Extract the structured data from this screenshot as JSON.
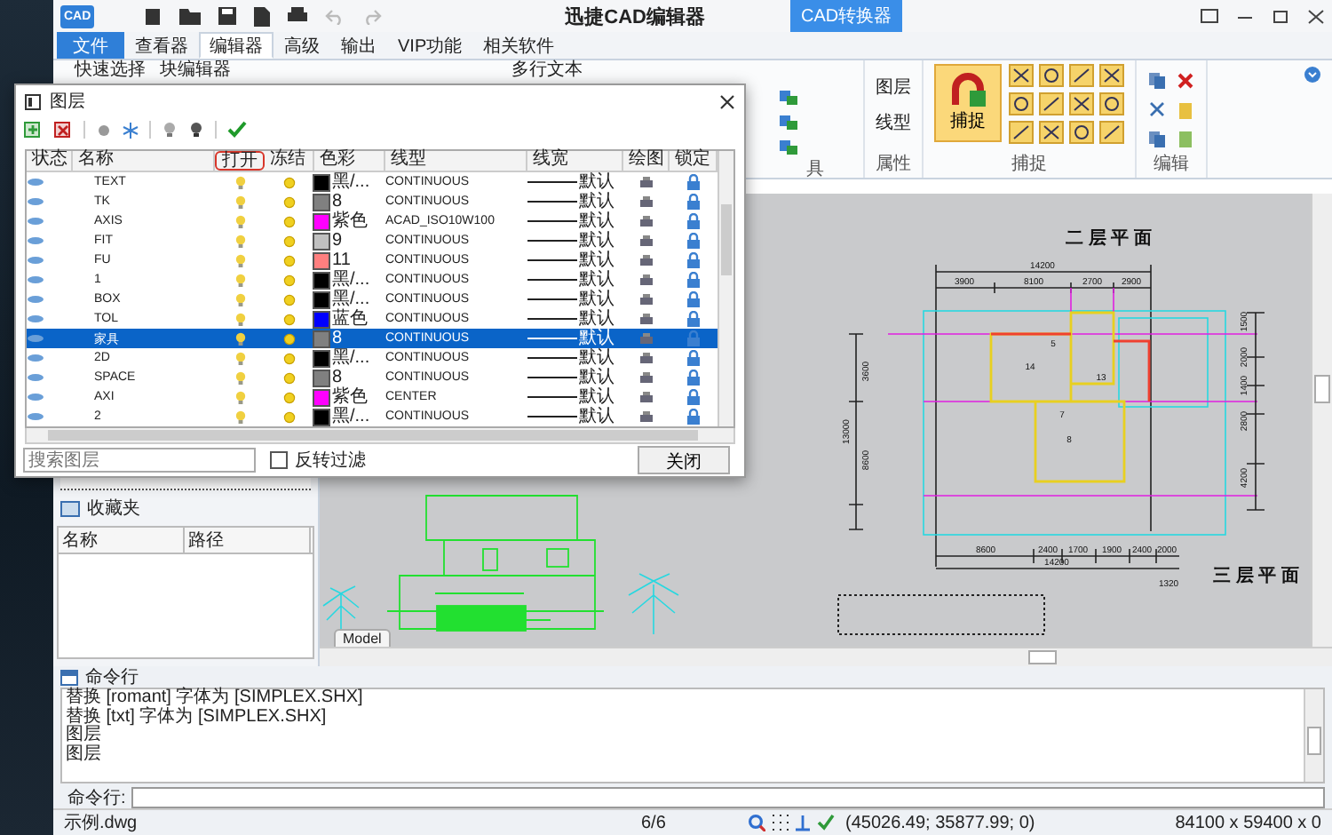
{
  "app": {
    "logo": "CAD",
    "title": "迅捷CAD编辑器",
    "converter_button": "CAD转换器"
  },
  "menu_tabs": [
    {
      "label": "文件",
      "kind": "file",
      "selected": false
    },
    {
      "label": "查看器",
      "kind": "tab",
      "selected": false
    },
    {
      "label": "编辑器",
      "kind": "tab",
      "selected": true
    },
    {
      "label": "高级",
      "kind": "tab",
      "selected": false
    },
    {
      "label": "输出",
      "kind": "tab",
      "selected": false
    },
    {
      "label": "VIP功能",
      "kind": "tab",
      "selected": false
    },
    {
      "label": "相关软件",
      "kind": "tab",
      "selected": false
    }
  ],
  "ribbon": {
    "left_buttons": [
      "快速选择",
      "块编辑器"
    ],
    "text_button": "多行文本",
    "tools_label": "具",
    "properties": {
      "label": "属性",
      "buttons": [
        "图层",
        "线型"
      ]
    },
    "snap": {
      "label": "捕捉",
      "button": "捕捉"
    },
    "edit": {
      "label": "编辑"
    }
  },
  "layer_dialog": {
    "title": "图层",
    "columns": [
      {
        "label": "状态",
        "highlighted": false
      },
      {
        "label": "名称",
        "highlighted": false
      },
      {
        "label": "打开",
        "highlighted": true
      },
      {
        "label": "冻结",
        "highlighted": false
      },
      {
        "label": "色彩",
        "highlighted": false
      },
      {
        "label": "线型",
        "highlighted": false
      },
      {
        "label": "线宽",
        "highlighted": false
      },
      {
        "label": "绘图",
        "highlighted": false
      },
      {
        "label": "锁定",
        "highlighted": false
      }
    ],
    "rows": [
      {
        "name": "TEXT",
        "color": "#000000",
        "color_label": "黑/...",
        "linetype": "CONTINUOUS",
        "lineweight": "默认",
        "selected": false
      },
      {
        "name": "TK",
        "color": "#808080",
        "color_label": "8",
        "linetype": "CONTINUOUS",
        "lineweight": "默认",
        "selected": false
      },
      {
        "name": "AXIS",
        "color": "#ff00ff",
        "color_label": "紫色",
        "linetype": "ACAD_ISO10W100",
        "lineweight": "默认",
        "selected": false
      },
      {
        "name": "FIT",
        "color": "#c0c0c0",
        "color_label": "9",
        "linetype": "CONTINUOUS",
        "lineweight": "默认",
        "selected": false
      },
      {
        "name": "FU",
        "color": "#ff7f7f",
        "color_label": "11",
        "linetype": "CONTINUOUS",
        "lineweight": "默认",
        "selected": false
      },
      {
        "name": "1",
        "color": "#000000",
        "color_label": "黑/...",
        "linetype": "CONTINUOUS",
        "lineweight": "默认",
        "selected": false
      },
      {
        "name": "BOX",
        "color": "#000000",
        "color_label": "黑/...",
        "linetype": "CONTINUOUS",
        "lineweight": "默认",
        "selected": false
      },
      {
        "name": "TOL",
        "color": "#0000ff",
        "color_label": "蓝色",
        "linetype": "CONTINUOUS",
        "lineweight": "默认",
        "selected": false
      },
      {
        "name": "家具",
        "color": "#808080",
        "color_label": "8",
        "linetype": "CONTINUOUS",
        "lineweight": "默认",
        "selected": true
      },
      {
        "name": "2D",
        "color": "#000000",
        "color_label": "黑/...",
        "linetype": "CONTINUOUS",
        "lineweight": "默认",
        "selected": false
      },
      {
        "name": "SPACE",
        "color": "#808080",
        "color_label": "8",
        "linetype": "CONTINUOUS",
        "lineweight": "默认",
        "selected": false
      },
      {
        "name": "AXI",
        "color": "#ff00ff",
        "color_label": "紫色",
        "linetype": "CENTER",
        "lineweight": "默认",
        "selected": false
      },
      {
        "name": "2",
        "color": "#000000",
        "color_label": "黑/...",
        "linetype": "CONTINUOUS",
        "lineweight": "默认",
        "selected": false
      }
    ],
    "search": {
      "placeholder": "搜索图层"
    },
    "invert_filter": {
      "label": "反转过滤",
      "checked": false
    },
    "close_button": "关闭"
  },
  "favorites": {
    "title": "收藏夹",
    "columns": [
      "名称",
      "路径"
    ]
  },
  "drawing": {
    "titles": [
      "二 层 平 面",
      "三 层 平 面"
    ],
    "top_dimensions": [
      "14200",
      "3900",
      "8100",
      "2700",
      "2900"
    ],
    "bottom_dimensions": [
      "8600",
      "2400",
      "1700",
      "1900",
      "2400",
      "2000",
      "14200",
      "1320"
    ],
    "left_dimensions": [
      "13000",
      "3600",
      "8600"
    ],
    "right_dimensions": [
      "1500",
      "2000",
      "1400",
      "2800",
      "4200"
    ],
    "room_numbers": [
      "14",
      "5",
      "13",
      "8",
      "7"
    ],
    "model_tab": "Model"
  },
  "command": {
    "title": "命令行",
    "lines": [
      "替换 [romant] 字体为 [SIMPLEX.SHX]",
      "替换 [txt] 字体为 [SIMPLEX.SHX]",
      "图层",
      "图层"
    ],
    "prompt": "命令行:"
  },
  "status_bar": {
    "file": "示例.dwg",
    "pages": "6/6",
    "coordinates": "(45026.49; 35877.99; 0)",
    "size": "84100 x 59400 x 0"
  }
}
